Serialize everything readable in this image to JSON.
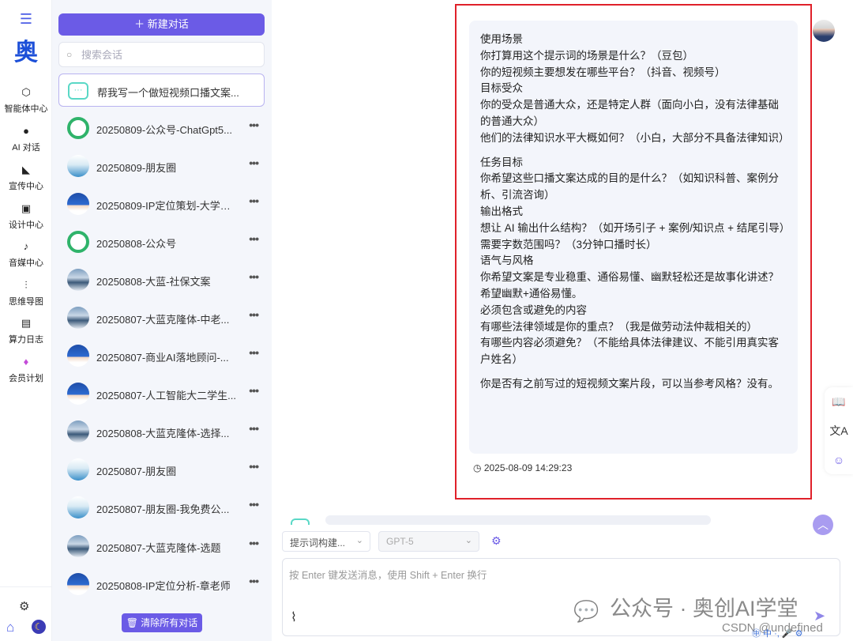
{
  "nav": {
    "logo_char": "奥",
    "items": [
      {
        "label": "智能体中心",
        "icon": "⬡"
      },
      {
        "label": "AI 对话",
        "icon": "●"
      },
      {
        "label": "宣传中心",
        "icon": "◣"
      },
      {
        "label": "设计中心",
        "icon": "▣"
      },
      {
        "label": "音媒中心",
        "icon": "♪"
      },
      {
        "label": "思维导图",
        "icon": "⫶"
      },
      {
        "label": "算力日志",
        "icon": "▤"
      },
      {
        "label": "会员计划",
        "icon": "♦"
      }
    ]
  },
  "sessions_panel": {
    "new_chat_label": "新建对话",
    "search_placeholder": "搜索会话",
    "clear_all_label": "清除所有对话",
    "sessions": [
      {
        "title": "帮我写一个做短视频口播文案...",
        "avatar": "chat",
        "active": true
      },
      {
        "title": "20250809-公众号-ChatGpt5...",
        "avatar": "gpt"
      },
      {
        "title": "20250809-朋友圈",
        "avatar": "glasses"
      },
      {
        "title": "20250809-IP定位策划-大学老...",
        "avatar": "person"
      },
      {
        "title": "20250808-公众号",
        "avatar": "gpt"
      },
      {
        "title": "20250808-大蓝-社保文案",
        "avatar": "mountain"
      },
      {
        "title": "20250807-大蓝克隆体-中老...",
        "avatar": "mountain"
      },
      {
        "title": "20250807-商业AI落地顾问-...",
        "avatar": "person"
      },
      {
        "title": "20250807-人工智能大二学生...",
        "avatar": "person"
      },
      {
        "title": "20250808-大蓝克隆体-选择...",
        "avatar": "mountain"
      },
      {
        "title": "20250807-朋友圈",
        "avatar": "glasses"
      },
      {
        "title": "20250807-朋友圈-我免费公...",
        "avatar": "glasses"
      },
      {
        "title": "20250807-大蓝克隆体-选题",
        "avatar": "mountain"
      },
      {
        "title": "20250808-IP定位分析-章老师",
        "avatar": "person"
      }
    ]
  },
  "message": {
    "lines": [
      "使用场景",
      "你打算用这个提示词的场景是什么？（豆包）",
      "你的短视频主要想发在哪些平台？（抖音、视频号）",
      "目标受众",
      "你的受众是普通大众，还是特定人群（面向小白，没有法律基础的普通大众）",
      "他们的法律知识水平大概如何？（小白，大部分不具备法律知识）",
      "",
      "任务目标",
      "你希望这些口播文案达成的目的是什么？（如知识科普、案例分析、引流咨询）",
      "输出格式",
      "想让 AI 输出什么结构？（如开场引子 + 案例/知识点 + 结尾引导）",
      "需要字数范围吗？（3分钟口播时长）",
      "语气与风格",
      "你希望文案是专业稳重、通俗易懂、幽默轻松还是故事化讲述？ 希望幽默+通俗易懂。",
      "必须包含或避免的内容",
      "有哪些法律领域是你的重点？（我是做劳动法仲裁相关的）",
      "有哪些内容必须避免？（不能给具体法律建议、不能引用真实客户姓名）",
      "",
      "你是否有之前写过的短视频文案片段，可以当参考风格？没有。"
    ],
    "timestamp": "2025-08-09 14:29:23"
  },
  "composer": {
    "prompt_selector": "提示词构建...",
    "model_selector": "GPT-5",
    "placeholder": "按 Enter 键发送消息，使用 Shift + Enter 换行"
  },
  "overlay": {
    "watermark": "公众号 · 奥创AI学堂",
    "csdn": "CSDN @undefined",
    "ime": "㊥ 中 ·, 🎤 ⚙"
  },
  "colors": {
    "accent": "#6b5be6",
    "highlight_border": "#e0212a",
    "bubble_bg": "#f3f5fb",
    "panel_bg": "#f4f6fb"
  }
}
